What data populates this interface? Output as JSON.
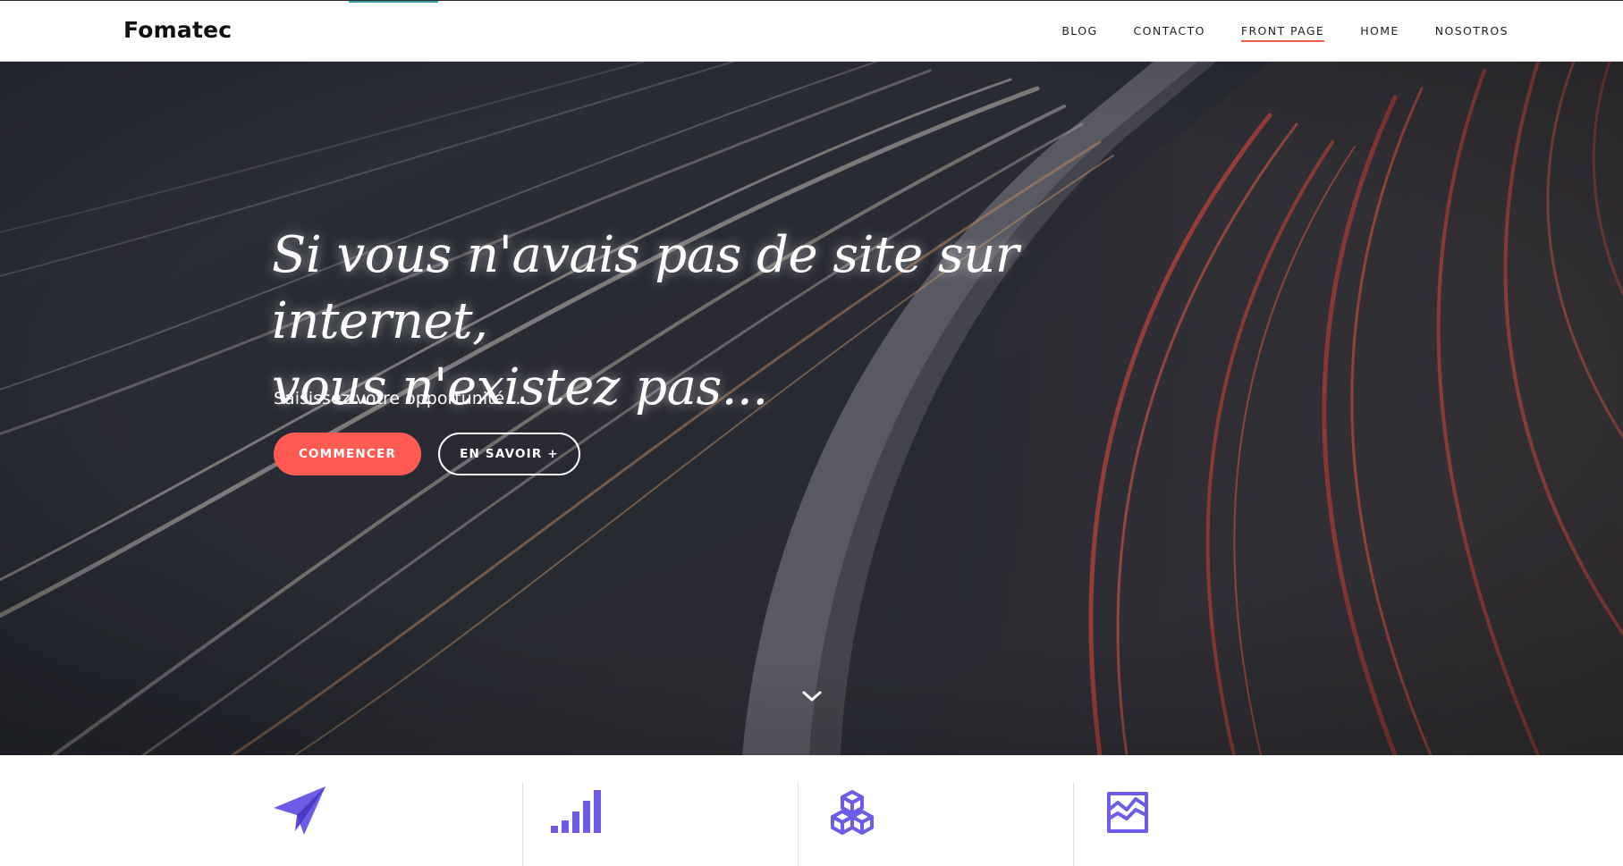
{
  "header": {
    "brand": "Fomatec",
    "nav": [
      {
        "label": "BLOG",
        "active": false
      },
      {
        "label": "CONTACTO",
        "active": false
      },
      {
        "label": "FRONT PAGE",
        "active": true
      },
      {
        "label": "HOME",
        "active": false
      },
      {
        "label": "NOSOTROS",
        "active": false
      }
    ],
    "active_underline_color": "#ff5b4f"
  },
  "hero": {
    "title_line1": "Si vous n'avais pas de site sur internet,",
    "title_line2": "vous n'existez pas...",
    "subtitle": "Saisissez votre opportunité...",
    "primary_button": "COMMENCER",
    "secondary_button": "EN SAVOIR +",
    "primary_color": "#ff5b52",
    "scroll_icon": "chevron-down-icon"
  },
  "features": {
    "icons": [
      "paper-plane-icon",
      "signal-bars-icon",
      "cubes-icon",
      "area-chart-icon"
    ],
    "icon_color": "#6c5ce7"
  }
}
